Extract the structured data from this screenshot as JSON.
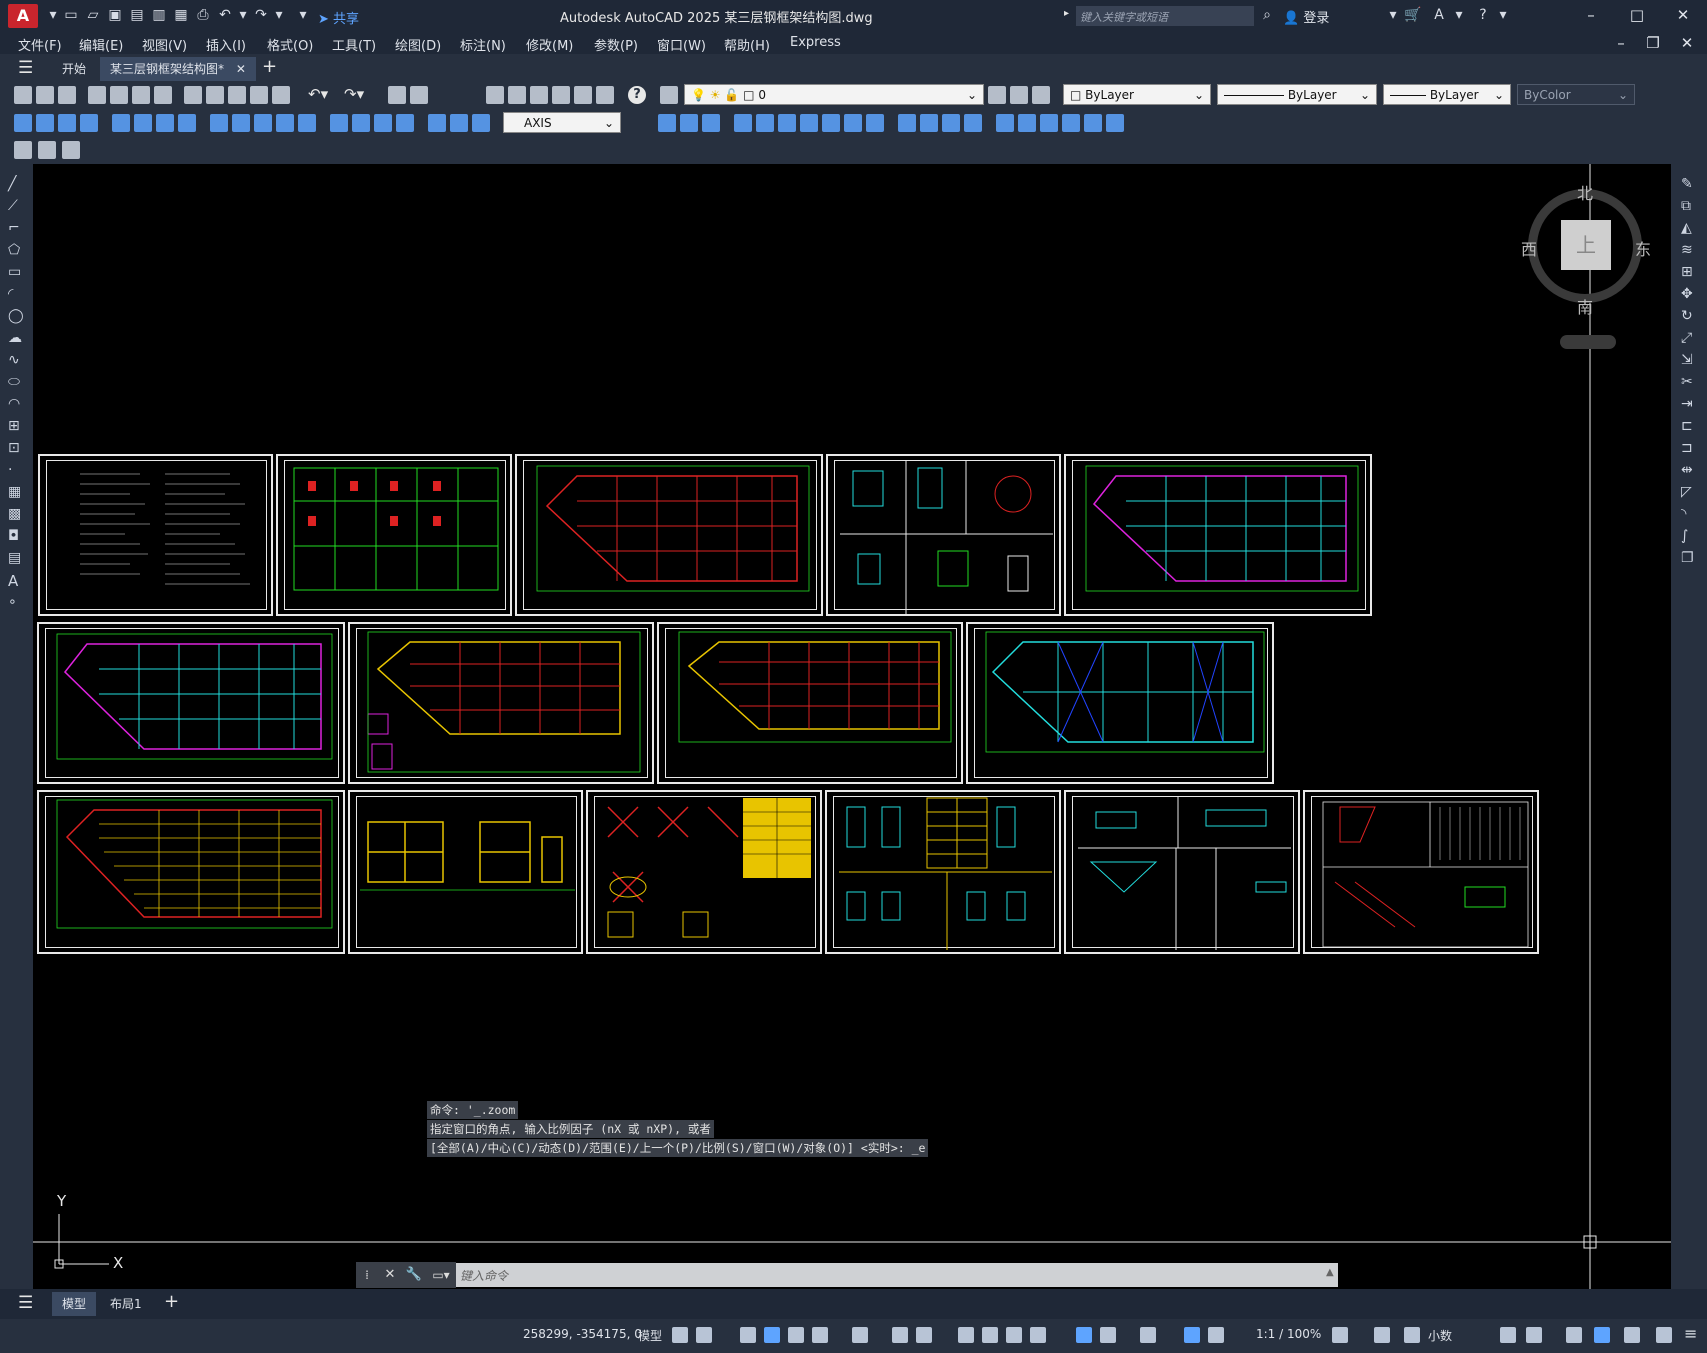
{
  "app": {
    "title": "Autodesk AutoCAD 2025    某三层钢框架结构图.dwg",
    "logo_letter": "A",
    "share_label": "共享",
    "search_placeholder": "键入关键字或短语",
    "signin_label": "登录"
  },
  "menu": [
    "文件(F)",
    "编辑(E)",
    "视图(V)",
    "插入(I)",
    "格式(O)",
    "工具(T)",
    "绘图(D)",
    "标注(N)",
    "修改(M)",
    "参数(P)",
    "窗口(W)",
    "帮助(H)",
    "Express"
  ],
  "tabs": {
    "start_label": "开始",
    "doc_label": "某三层钢框架结构图*",
    "add_label": "+"
  },
  "toolbar": {
    "layer_value": "0",
    "color_value": "ByLayer",
    "linetype_value": "ByLayer",
    "lineweight_value": "ByLayer",
    "plotstyle_value": "ByColor",
    "dimstyle_value": "AXIS"
  },
  "viewcube": {
    "north": "北",
    "south": "南",
    "east": "东",
    "west": "西",
    "top": "上"
  },
  "ucs": {
    "x": "X",
    "y": "Y"
  },
  "command": {
    "history": [
      "命令: '_.zoom",
      "指定窗口的角点, 输入比例因子 (nX 或 nXP), 或者",
      "[全部(A)/中心(C)/动态(D)/范围(E)/上一个(P)/比例(S)/窗口(W)/对象(O)] <实时>: _e"
    ],
    "input_placeholder": "键入命令"
  },
  "layouts": {
    "model_label": "模型",
    "layout1_label": "布局1",
    "add_label": "+"
  },
  "status": {
    "coords": "258299, -354175, 0",
    "model_label": "模型",
    "scale_label": "1:1 / 100%",
    "units_label": "小数"
  },
  "colors": {
    "logo": "#c9252d",
    "accent": "#5ea4ff",
    "canvas": "#000000",
    "sheet_border": "#e8e8e8"
  }
}
